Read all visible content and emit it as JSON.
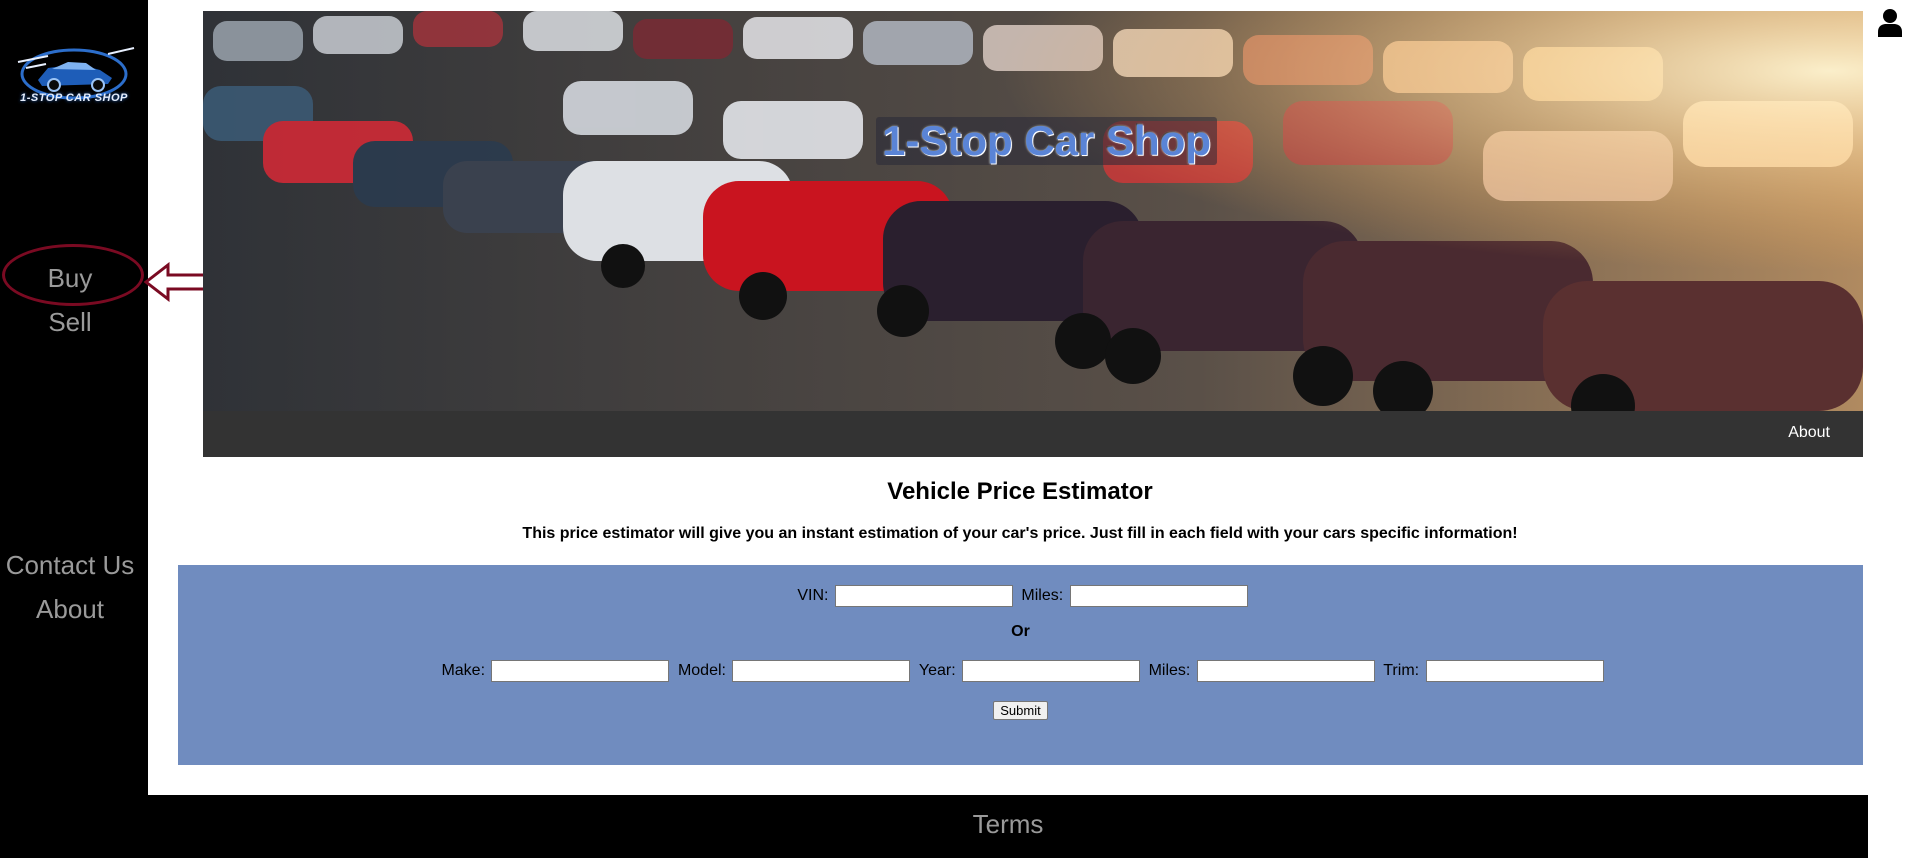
{
  "sidebar": {
    "logo_text": "1-STOP CAR SHOP",
    "nav": [
      {
        "label": "Buy"
      },
      {
        "label": "Sell"
      },
      {
        "label": "Contact Us"
      },
      {
        "label": "About"
      }
    ]
  },
  "header": {
    "banner_title": "1-Stop Car Shop",
    "topbar_about": "About"
  },
  "main": {
    "title": "Vehicle Price Estimator",
    "subtitle": "This price estimator will give you an instant estimation of your car's price. Just fill in each field with your cars specific information!",
    "form": {
      "vin_label": "VIN:",
      "miles_label": "Miles:",
      "or_label": "Or",
      "make_label": "Make:",
      "model_label": "Model:",
      "year_label": "Year:",
      "miles2_label": "Miles:",
      "trim_label": "Trim:",
      "submit_label": "Submit"
    }
  },
  "footer": {
    "terms": "Terms"
  },
  "colors": {
    "sidebar_bg": "#000000",
    "topbar_bg": "#333333",
    "form_bg": "#708cbf",
    "annotation": "#7a0a22",
    "nav_text": "#9a9a9a"
  },
  "icons": [
    "logo-car-icon",
    "user-icon",
    "annotation-arrow-icon"
  ]
}
